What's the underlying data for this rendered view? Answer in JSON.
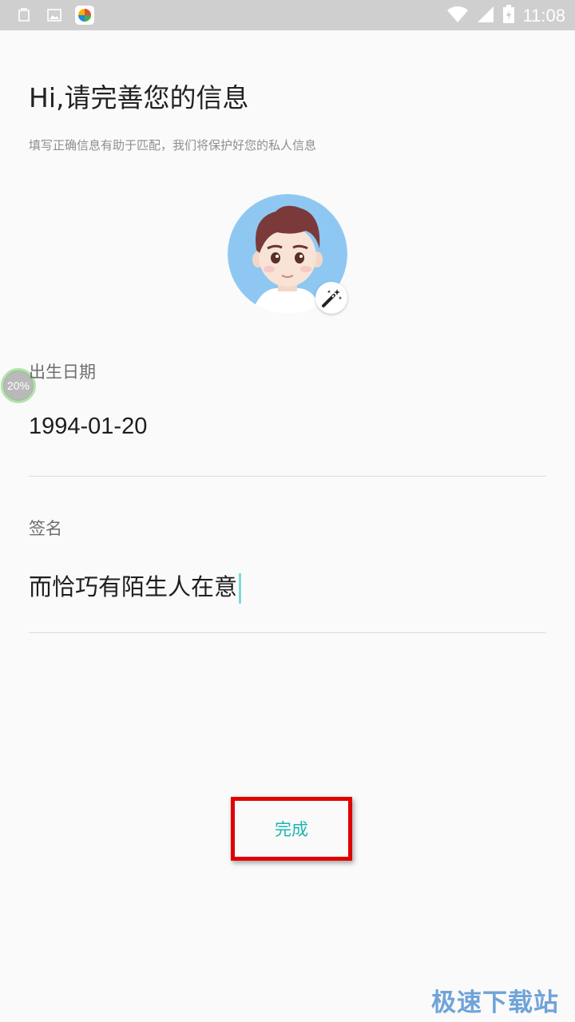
{
  "status_bar": {
    "time": "11:08",
    "left_icons": [
      "clipboard-icon",
      "image-icon",
      "app-store-icon"
    ],
    "right_icons": [
      "wifi-icon",
      "signal-icon",
      "battery-charging-icon"
    ]
  },
  "header": {
    "title": "Hi,请完善您的信息",
    "subtitle": "填写正确信息有助于匹配，我们将保护好您的私人信息"
  },
  "avatar": {
    "icon": "avatar-boy-illustration",
    "edit_icon": "magic-wand-icon"
  },
  "progress": {
    "label": "20%",
    "value": 0.2
  },
  "form": {
    "birth_date": {
      "label": "出生日期",
      "value": "1994-01-20"
    },
    "signature": {
      "label": "签名",
      "value": "而恰巧有陌生人在意"
    }
  },
  "actions": {
    "done_label": "完成"
  },
  "watermark": {
    "text": "极速下载站"
  },
  "colors": {
    "accent": "#1ab7b0",
    "highlight_border": "#e00000",
    "avatar_bg": "#8ec8f2",
    "status_bar_bg": "#cfcfcf"
  }
}
